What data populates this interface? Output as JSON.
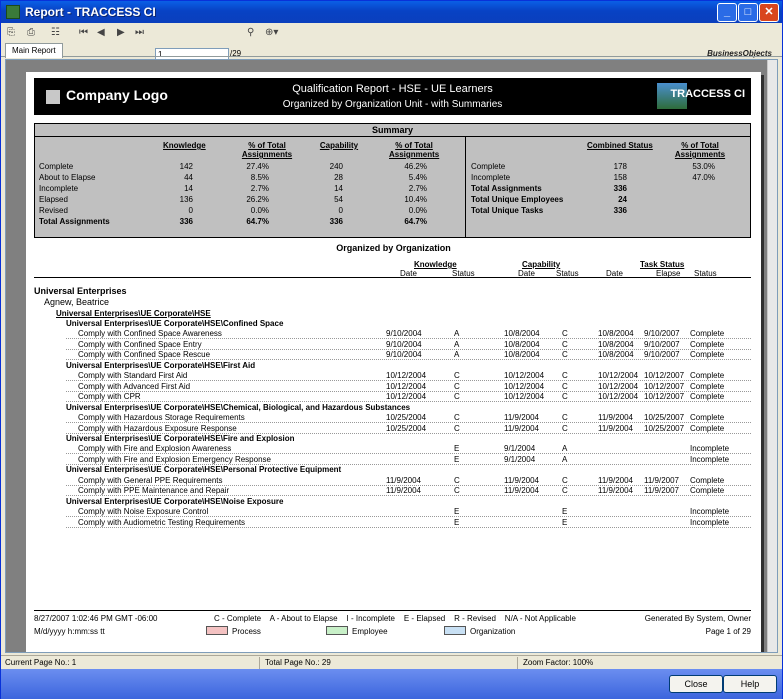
{
  "window": {
    "title": "Report - TRACCESS CI"
  },
  "toolbar": {
    "page_value": "1",
    "page_total": "/29",
    "brand": "BusinessObjects"
  },
  "tabs": [
    {
      "label": "Main Report"
    }
  ],
  "report": {
    "company_logo": "Company Logo",
    "title": "Qualification Report - HSE - UE Learners",
    "subtitle": "Organized by Organization Unit - with Summaries",
    "product_logo": "TRACCESS CI"
  },
  "summary": {
    "title": "Summary",
    "left_headers": [
      "Knowledge",
      "% of Total Assignments",
      "Capability",
      "% of Total Assignments"
    ],
    "left_rows": [
      {
        "label": "Complete",
        "k": "142",
        "kp": "27.4%",
        "c": "240",
        "cp": "46.2%",
        "bold": false
      },
      {
        "label": "About to Elapse",
        "k": "44",
        "kp": "8.5%",
        "c": "28",
        "cp": "5.4%",
        "bold": false
      },
      {
        "label": "Incomplete",
        "k": "14",
        "kp": "2.7%",
        "c": "14",
        "cp": "2.7%",
        "bold": false
      },
      {
        "label": "Elapsed",
        "k": "136",
        "kp": "26.2%",
        "c": "54",
        "cp": "10.4%",
        "bold": false
      },
      {
        "label": "Revised",
        "k": "0",
        "kp": "0.0%",
        "c": "0",
        "cp": "0.0%",
        "bold": false
      },
      {
        "label": "Total Assignments",
        "k": "336",
        "kp": "64.7%",
        "c": "336",
        "cp": "64.7%",
        "bold": true
      }
    ],
    "right_headers": [
      "Combined Status",
      "% of Total Assignments"
    ],
    "right_rows": [
      {
        "label": "Complete",
        "v": "178",
        "p": "53.0%",
        "bold": false
      },
      {
        "label": "Incomplete",
        "v": "158",
        "p": "47.0%",
        "bold": false
      },
      {
        "label": "Total Assignments",
        "v": "336",
        "p": "",
        "bold": true
      },
      {
        "label": "Total Unique Employees",
        "v": "24",
        "p": "",
        "bold": true
      },
      {
        "label": "Total Unique Tasks",
        "v": "336",
        "p": "",
        "bold": true
      }
    ]
  },
  "organized": {
    "title": "Organized by Organization",
    "groups": [
      "Knowledge",
      "Capability",
      "Task Status"
    ],
    "cols": [
      "Date",
      "Status",
      "Date",
      "Status",
      "Date",
      "Elapse",
      "Status"
    ]
  },
  "body": {
    "org": "Universal Enterprises",
    "employee": "Agnew, Beatrice",
    "unit": "Universal Enterprises\\UE Corporate\\HSE",
    "rows": [
      {
        "type": "sec",
        "text": "Universal Enterprises\\UE Corporate\\HSE\\Confined Space"
      },
      {
        "type": "task",
        "text": "Comply with Confined Space Awareness",
        "v": [
          "9/10/2004",
          "A",
          "10/8/2004",
          "C",
          "10/8/2004",
          "9/10/2007",
          "Complete"
        ]
      },
      {
        "type": "task",
        "text": "Comply with Confined Space Entry",
        "v": [
          "9/10/2004",
          "A",
          "10/8/2004",
          "C",
          "10/8/2004",
          "9/10/2007",
          "Complete"
        ]
      },
      {
        "type": "task",
        "text": "Comply with Confined Space Rescue",
        "v": [
          "9/10/2004",
          "A",
          "10/8/2004",
          "C",
          "10/8/2004",
          "9/10/2007",
          "Complete"
        ]
      },
      {
        "type": "sec",
        "text": "Universal Enterprises\\UE Corporate\\HSE\\First Aid"
      },
      {
        "type": "task",
        "text": "Comply with Standard First Aid",
        "v": [
          "10/12/2004",
          "C",
          "10/12/2004",
          "C",
          "10/12/2004",
          "10/12/2007",
          "Complete"
        ]
      },
      {
        "type": "task",
        "text": "Comply with Advanced First Aid",
        "v": [
          "10/12/2004",
          "C",
          "10/12/2004",
          "C",
          "10/12/2004",
          "10/12/2007",
          "Complete"
        ]
      },
      {
        "type": "task",
        "text": "Comply with CPR",
        "v": [
          "10/12/2004",
          "C",
          "10/12/2004",
          "C",
          "10/12/2004",
          "10/12/2007",
          "Complete"
        ]
      },
      {
        "type": "sec",
        "text": "Universal Enterprises\\UE Corporate\\HSE\\Chemical, Biological, and Hazardous Substances"
      },
      {
        "type": "task",
        "text": "Comply with Hazardous Storage Requirements",
        "v": [
          "10/25/2004",
          "C",
          "11/9/2004",
          "C",
          "11/9/2004",
          "10/25/2007",
          "Complete"
        ]
      },
      {
        "type": "task",
        "text": "Comply with Hazardous Exposure Response",
        "v": [
          "10/25/2004",
          "C",
          "11/9/2004",
          "C",
          "11/9/2004",
          "10/25/2007",
          "Complete"
        ]
      },
      {
        "type": "sec",
        "text": "Universal Enterprises\\UE Corporate\\HSE\\Fire and Explosion"
      },
      {
        "type": "task",
        "text": "Comply with Fire and Explosion Awareness",
        "v": [
          "",
          "E",
          "9/1/2004",
          "A",
          "",
          "",
          "Incomplete"
        ]
      },
      {
        "type": "task",
        "text": "Comply with Fire and Explosion Emergency Response",
        "v": [
          "",
          "E",
          "9/1/2004",
          "A",
          "",
          "",
          "Incomplete"
        ]
      },
      {
        "type": "sec",
        "text": "Universal Enterprises\\UE Corporate\\HSE\\Personal Protective Equipment"
      },
      {
        "type": "task",
        "text": "Comply with General PPE Requirements",
        "v": [
          "11/9/2004",
          "C",
          "11/9/2004",
          "C",
          "11/9/2004",
          "11/9/2007",
          "Complete"
        ]
      },
      {
        "type": "task",
        "text": "Comply with PPE Maintenance and Repair",
        "v": [
          "11/9/2004",
          "C",
          "11/9/2004",
          "C",
          "11/9/2004",
          "11/9/2007",
          "Complete"
        ]
      },
      {
        "type": "sec",
        "text": "Universal Enterprises\\UE Corporate\\HSE\\Noise Exposure"
      },
      {
        "type": "task",
        "text": "Comply with Noise Exposure Control",
        "v": [
          "",
          "E",
          "",
          "E",
          "",
          "",
          "Incomplete"
        ]
      },
      {
        "type": "task",
        "text": "Comply with Audiometric Testing Requirements",
        "v": [
          "",
          "E",
          "",
          "E",
          "",
          "",
          "Incomplete"
        ]
      }
    ]
  },
  "footer": {
    "datetime": "8/27/2007  1:02:46 PM GMT -06:00",
    "format": "M/d/yyyy h:mm:ss tt",
    "legend_codes": "C - Complete    A - About to Elapse    I - Incomplete    E - Elapsed    R - Revised    N/A - Not Applicable",
    "legend_items": [
      {
        "label": "Process",
        "color": "#f4c2c2"
      },
      {
        "label": "Employee",
        "color": "#c8f0c8"
      },
      {
        "label": "Organization",
        "color": "#c8e0f4"
      }
    ],
    "generated": "Generated By System, Owner",
    "page": "Page 1 of 29"
  },
  "statusbar": {
    "current": "Current Page No.: 1",
    "total": "Total Page No.: 29",
    "zoom": "Zoom Factor: 100%"
  },
  "buttons": {
    "close": "Close",
    "help": "Help"
  }
}
